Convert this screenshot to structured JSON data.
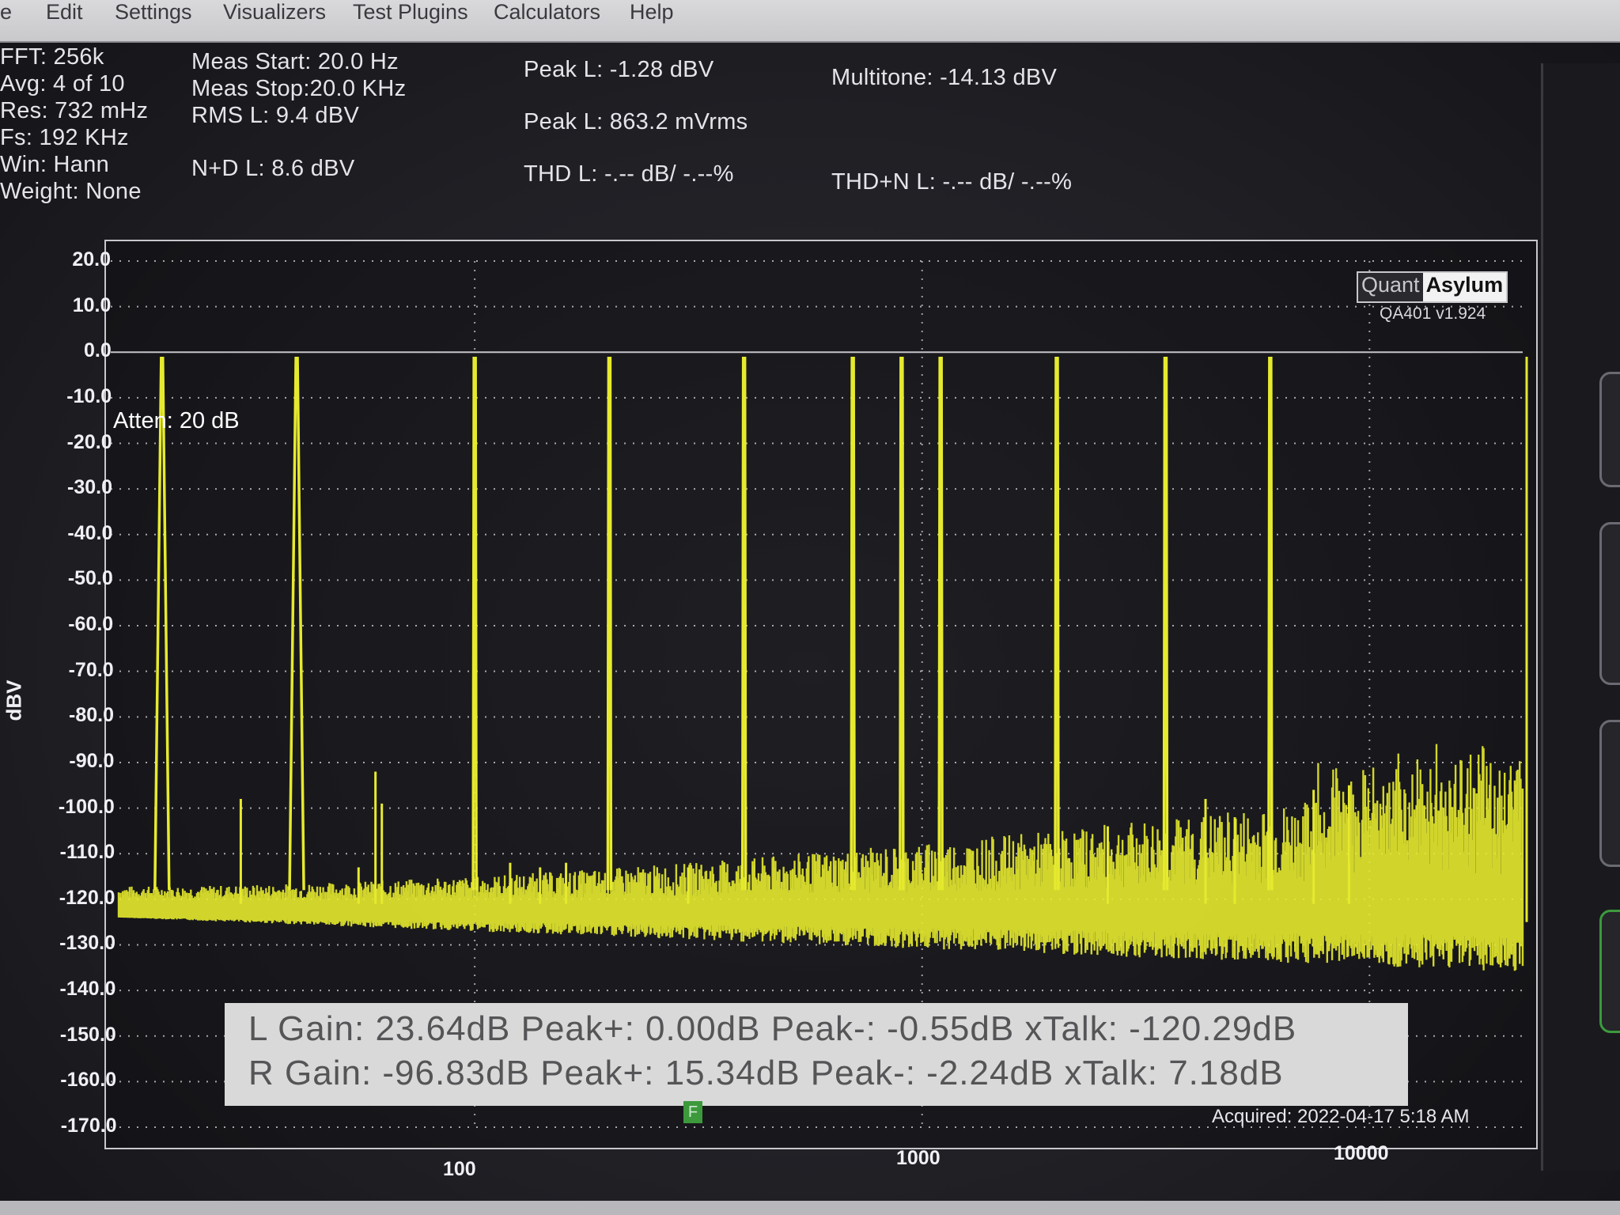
{
  "menu": {
    "items": [
      "le",
      "Edit",
      "Settings",
      "Visualizers",
      "Test Plugins",
      "Calculators",
      "Help"
    ]
  },
  "stats": {
    "col1": [
      "FFT: 256k",
      "Avg: 4 of 10",
      "Res: 732 mHz",
      "Fs: 192 KHz",
      "Win: Hann",
      "Weight: None"
    ],
    "meas_start": "Meas Start: 20.0 Hz",
    "meas_stop": "Meas Stop:20.0 KHz",
    "rms_l": "RMS L: 9.4 dBV",
    "nd_l": "N+D L: 8.6 dBV",
    "peak_l_dbv": "Peak L: -1.28 dBV",
    "peak_l_mvrms": "Peak L: 863.2 mVrms",
    "thd_l": "THD L: -.-- dB/ -.--%",
    "multitone": "Multitone: -14.13  dBV",
    "thdn_l": "THD+N L: -.-- dB/ -.--%"
  },
  "plot": {
    "y_label": "dBV",
    "y_ticks": [
      "20.0",
      "10.0",
      "0.0",
      "-10.0",
      "-20.0",
      "-30.0",
      "-40.0",
      "-50.0",
      "-60.0",
      "-70.0",
      "-80.0",
      "-90.0",
      "-100.0",
      "-110.0",
      "-120.0",
      "-130.0",
      "-140.0",
      "-150.0",
      "-160.0",
      "-170.0"
    ],
    "x_ticks": [
      "100",
      "1000",
      "10000"
    ],
    "atten_label": "Atten: 20 dB",
    "logo_quant": "Quant",
    "logo_asylum": "Asylum",
    "version": "QA401 v1.924",
    "marker_label": "F",
    "acquired": "Acquired: 2022-04-17  5:18 AM",
    "trace_color": "#e6ea2e",
    "tone_freqs_hz": [
      20,
      40,
      100,
      200,
      400,
      700,
      900,
      1100,
      2000,
      3500,
      6000
    ],
    "tone_levels_dbv": [
      -1.3,
      -1.3,
      -1.3,
      -1.3,
      -1.3,
      -1.3,
      -1.3,
      -1.3,
      -1.3,
      -1.3,
      -1.3
    ],
    "x_range_hz": [
      16,
      22000
    ],
    "y_range_dbv": [
      -170,
      20
    ]
  },
  "summary": {
    "line1": "L Gain: 23.64dB  Peak+: 0.00dB  Peak-: -0.55dB  xTalk: -120.29dB",
    "line2": "R Gain: -96.83dB  Peak+: 15.34dB  Peak-: -2.24dB  xTalk: 7.18dB"
  }
}
